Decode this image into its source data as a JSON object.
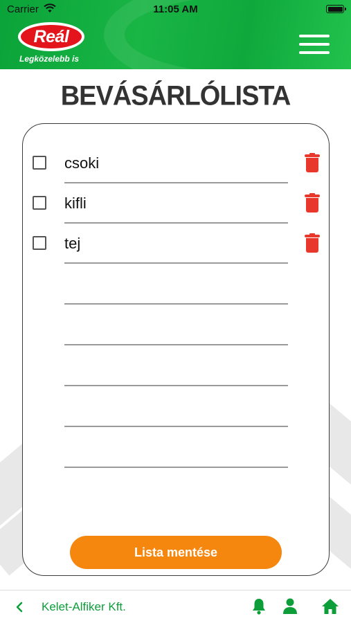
{
  "status_bar": {
    "carrier": "Carrier",
    "time": "11:05 AM"
  },
  "header": {
    "brand": "Reál",
    "tagline": "Legközelebb is",
    "menu_icon": "hamburger-menu-icon"
  },
  "page": {
    "title": "BEVÁSÁRLÓLISTA"
  },
  "shopping_list": {
    "items": [
      {
        "label": "csoki",
        "checked": false
      },
      {
        "label": "kifli",
        "checked": false
      },
      {
        "label": "tej",
        "checked": false
      }
    ],
    "empty_rows": 5,
    "save_label": "Lista mentése"
  },
  "bottom_bar": {
    "company": "Kelet-Alfiker Kft.",
    "icons": [
      "back-chevron-icon",
      "bell-icon",
      "user-icon",
      "home-icon"
    ]
  },
  "colors": {
    "header_green": "#19b545",
    "accent_green": "#0d9e3a",
    "brand_red": "#e3141b",
    "delete_red": "#e8382c",
    "save_orange": "#f5870f",
    "title_text": "#333333"
  }
}
